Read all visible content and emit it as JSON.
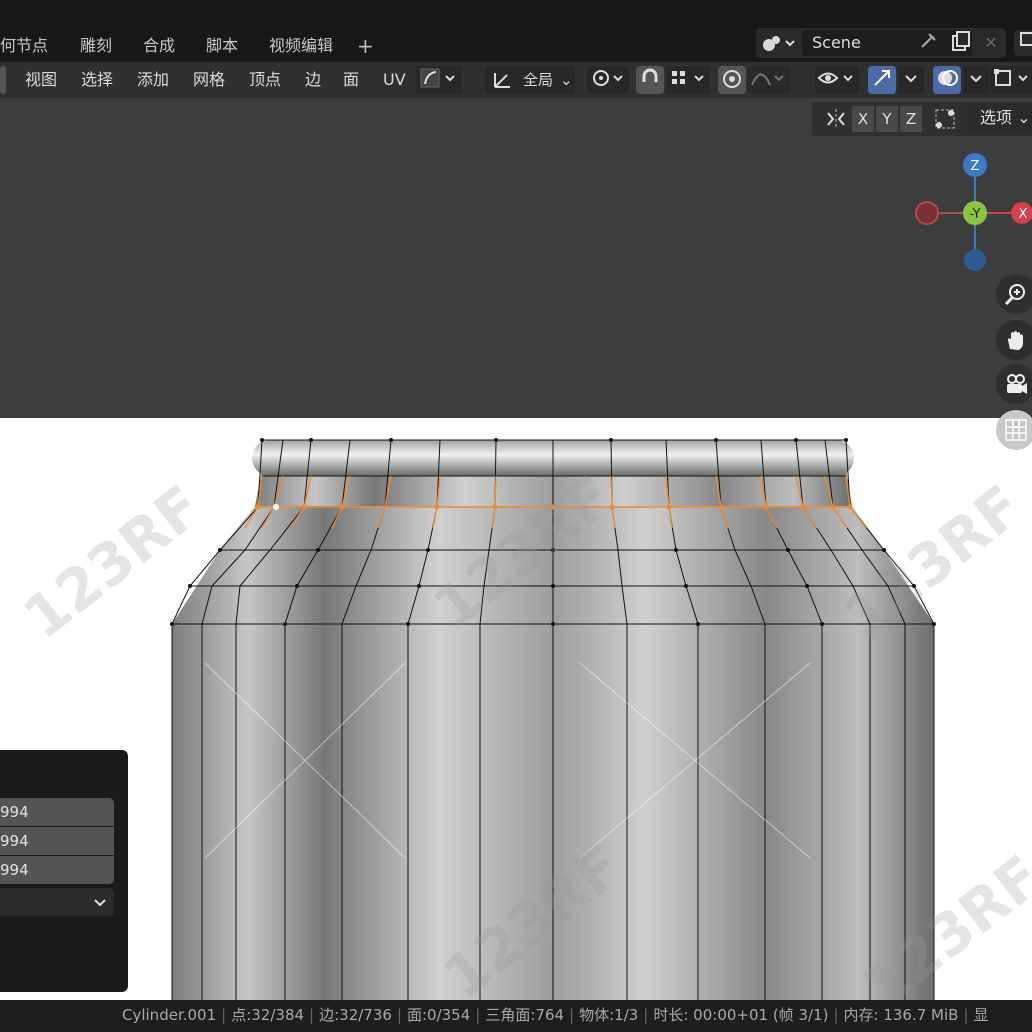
{
  "workspace_tabs": [
    "何节点",
    "雕刻",
    "合成",
    "脚本",
    "视频编辑"
  ],
  "add_workspace": "+",
  "scene": {
    "name": "Scene"
  },
  "menu": [
    "视图",
    "选择",
    "添加",
    "网格",
    "顶点",
    "边",
    "面",
    "UV"
  ],
  "transform_orientation": "全局",
  "axis_chips": [
    "X",
    "Y",
    "Z"
  ],
  "options_label": "选项",
  "gizmo": {
    "z": "Z",
    "y": "-Y",
    "x": "X",
    "colors": {
      "x": "#d6414e",
      "y": "#8bc53f",
      "z": "#3d78c9"
    }
  },
  "panel": {
    "fields": [
      "994",
      "994",
      "994"
    ]
  },
  "status": {
    "object": "Cylinder.001",
    "verts": "点:32/384",
    "edges": "边:32/736",
    "faces": "面:0/354",
    "tris": "三角面:764",
    "objects": "物体:1/3",
    "time": "时长: 00:00+01 (帧 3/1)",
    "memory": "内存: 136.7 MiB",
    "extra": "显"
  },
  "watermark": "123RF",
  "colors": {
    "accent": "#4a6ba5",
    "selection": "#f08a2a"
  }
}
